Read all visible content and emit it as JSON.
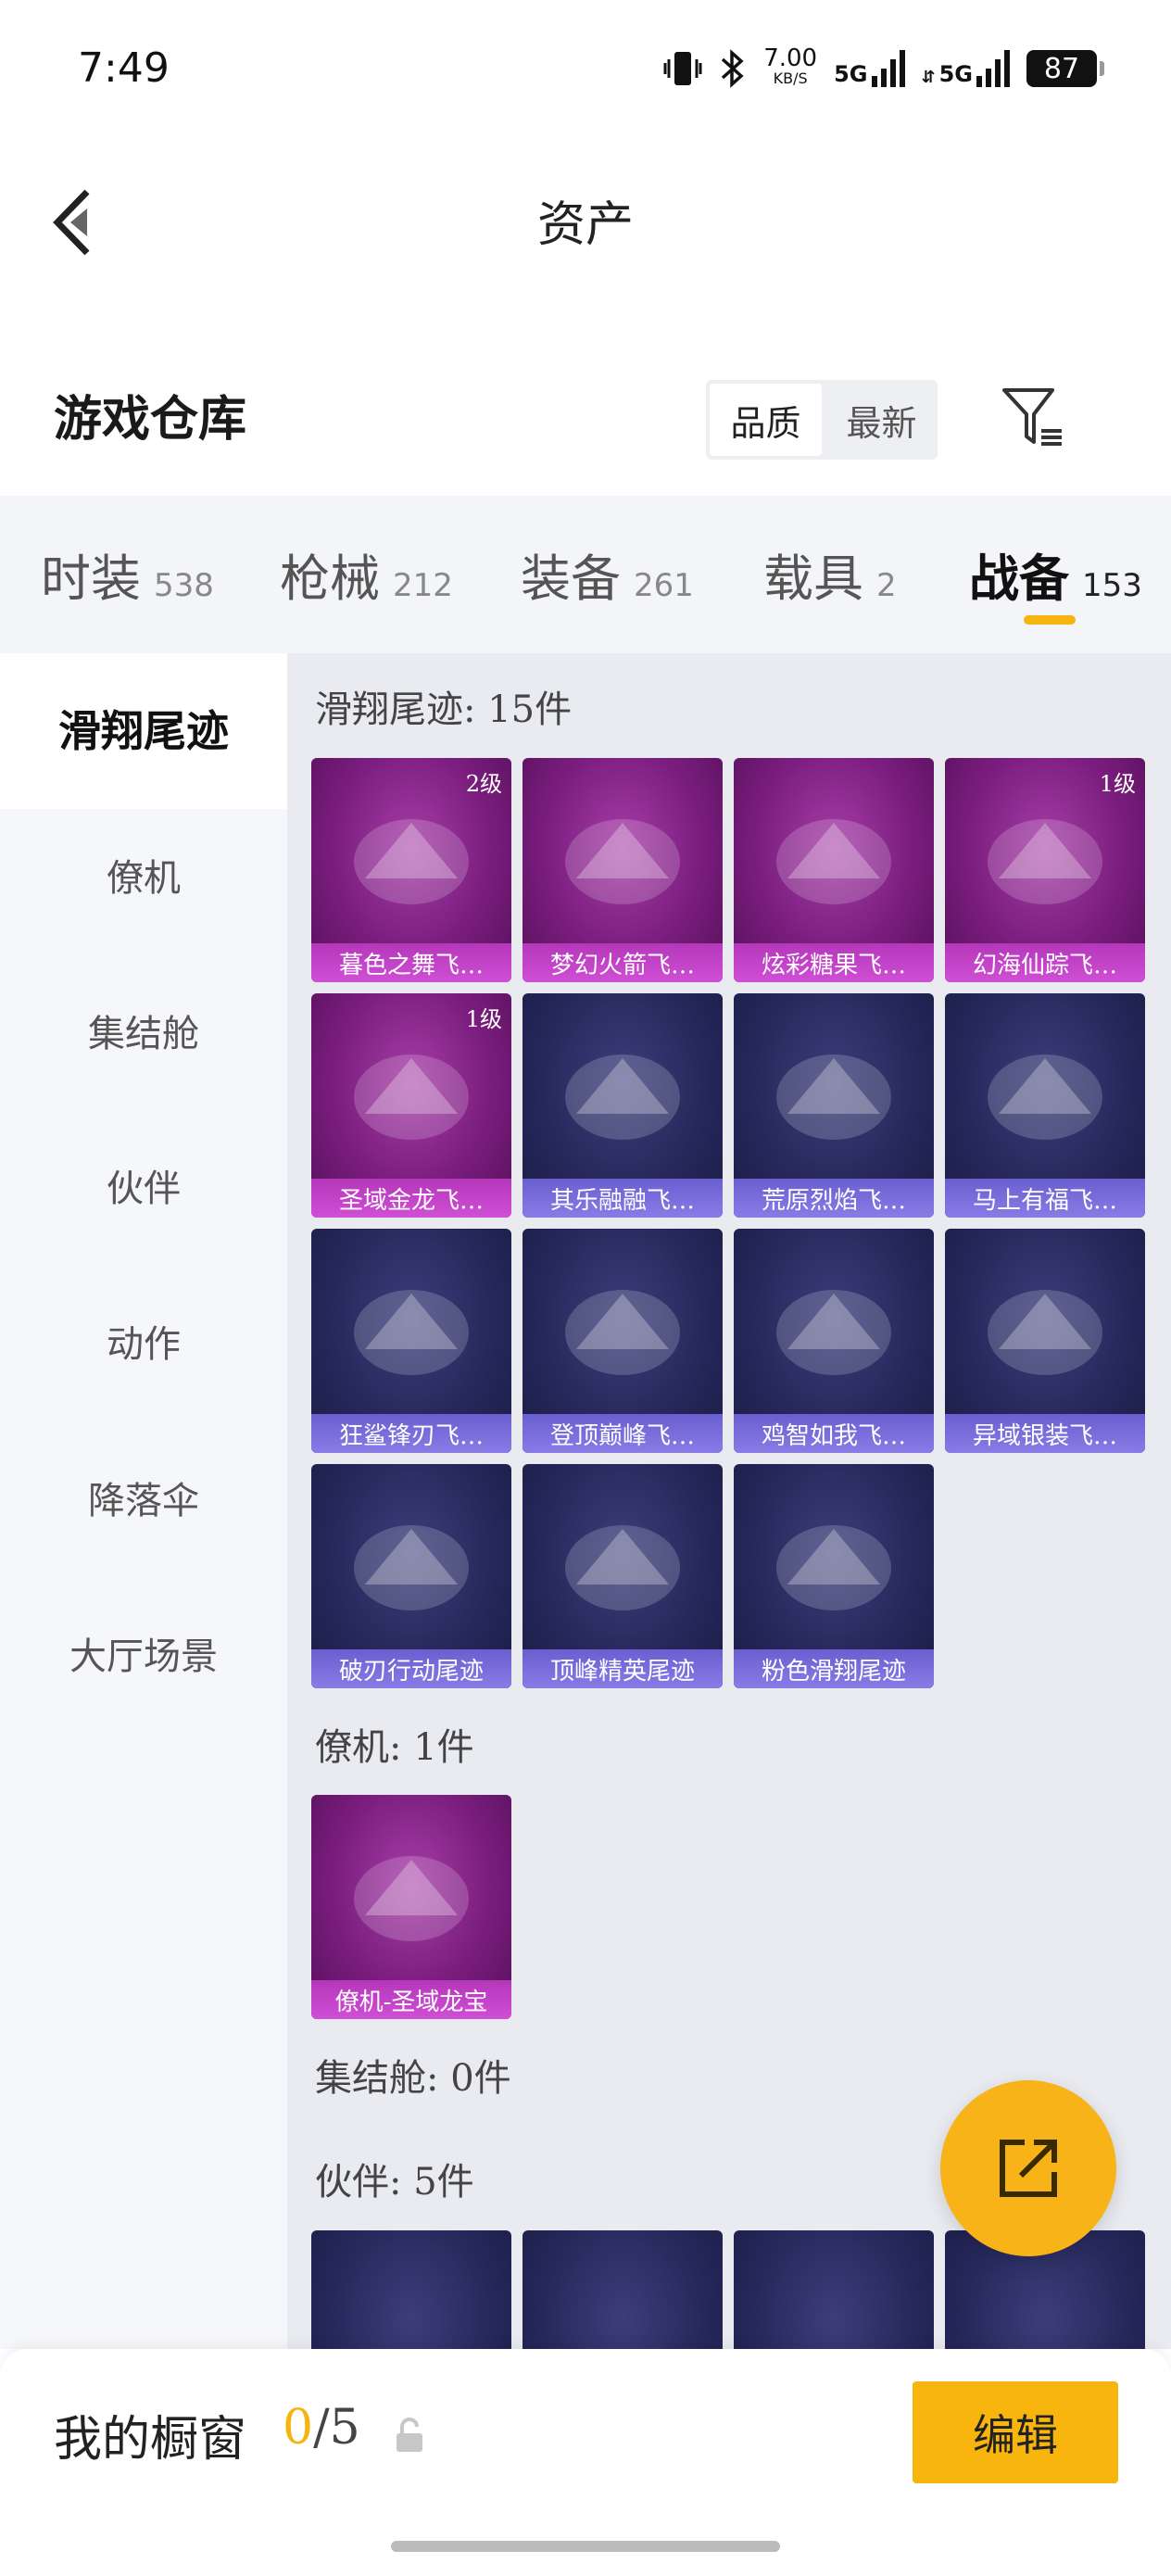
{
  "status_bar": {
    "time": "7:49",
    "speed_value": "7.00",
    "speed_unit": "KB/S",
    "signal1_label": "5G",
    "signal2_label": "5G",
    "battery": "87"
  },
  "header": {
    "title": "资产",
    "back_icon": "chevron-left-icon"
  },
  "section": {
    "title": "游戏仓库",
    "sort_options": [
      "品质",
      "最新"
    ],
    "sort_selected": "品质",
    "filter_icon": "filter-icon"
  },
  "tabs": [
    {
      "label": "时装",
      "count": "538"
    },
    {
      "label": "枪械",
      "count": "212"
    },
    {
      "label": "装备",
      "count": "261"
    },
    {
      "label": "载具",
      "count": "2"
    },
    {
      "label": "战备",
      "count": "153",
      "active": true
    }
  ],
  "sidebar": {
    "items": [
      "滑翔尾迹",
      "僚机",
      "集结舱",
      "伙伴",
      "动作",
      "降落伞",
      "大厅场景"
    ],
    "active": "滑翔尾迹"
  },
  "groups": {
    "glide": {
      "label": "滑翔尾迹: 15件",
      "items": [
        {
          "name": "暮色之舞飞…",
          "level": "2级",
          "rarity": "purple"
        },
        {
          "name": "梦幻火箭飞…",
          "level": "",
          "rarity": "purple"
        },
        {
          "name": "炫彩糖果飞…",
          "level": "",
          "rarity": "purple"
        },
        {
          "name": "幻海仙踪飞…",
          "level": "1级",
          "rarity": "purple"
        },
        {
          "name": "圣域金龙飞…",
          "level": "1级",
          "rarity": "purple"
        },
        {
          "name": "其乐融融飞…",
          "level": "",
          "rarity": "blue"
        },
        {
          "name": "荒原烈焰飞…",
          "level": "",
          "rarity": "blue"
        },
        {
          "name": "马上有福飞…",
          "level": "",
          "rarity": "blue"
        },
        {
          "name": "狂鲨锋刃飞…",
          "level": "",
          "rarity": "blue"
        },
        {
          "name": "登顶巅峰飞…",
          "level": "",
          "rarity": "blue"
        },
        {
          "name": "鸡智如我飞…",
          "level": "",
          "rarity": "blue"
        },
        {
          "name": "异域银装飞…",
          "level": "",
          "rarity": "blue"
        },
        {
          "name": "破刃行动尾迹",
          "level": "",
          "rarity": "blue"
        },
        {
          "name": "顶峰精英尾迹",
          "level": "",
          "rarity": "blue"
        },
        {
          "name": "粉色滑翔尾迹",
          "level": "",
          "rarity": "blue"
        }
      ]
    },
    "wingman": {
      "label": "僚机: 1件",
      "items": [
        {
          "name": "僚机-圣域龙宝",
          "level": "",
          "rarity": "purple"
        }
      ]
    },
    "pod": {
      "label": "集结舱: 0件"
    },
    "partner": {
      "label": "伙伴: 5件"
    }
  },
  "fab_icon": "external-link-icon",
  "bottom_bar": {
    "label": "我的橱窗",
    "count_current": "0",
    "count_total": "/5",
    "lock_icon": "lock-icon",
    "edit_label": "编辑"
  }
}
